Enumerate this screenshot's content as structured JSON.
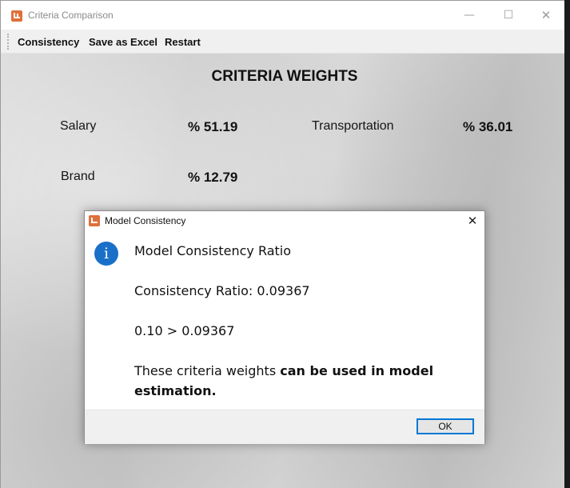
{
  "window": {
    "title": "Criteria Comparison",
    "minimize": "—",
    "maximize": "☐",
    "close": "✕"
  },
  "menu": {
    "items": [
      "Consistency",
      "Save as Excel",
      "Restart"
    ]
  },
  "main": {
    "heading": "CRITERIA WEIGHTS",
    "criteria": [
      {
        "label": "Salary",
        "value": "% 51.19"
      },
      {
        "label": "Transportation",
        "value": "% 36.01"
      },
      {
        "label": "Brand",
        "value": "% 12.79"
      }
    ]
  },
  "dialog": {
    "title": "Model Consistency",
    "close": "✕",
    "icon": "info-icon",
    "icon_glyph": "i",
    "line1": "Model Consistency Ratio",
    "line2": "Consistency Ratio: 0.09367",
    "line3": "0.10 > 0.09367",
    "line4_prefix": "These criteria weights ",
    "line4_bold": "can be used in model estimation.",
    "ok_label": "OK"
  },
  "colors": {
    "app_icon": "#e0703a",
    "info_icon": "#1a70c8",
    "ok_border": "#0078d7"
  }
}
